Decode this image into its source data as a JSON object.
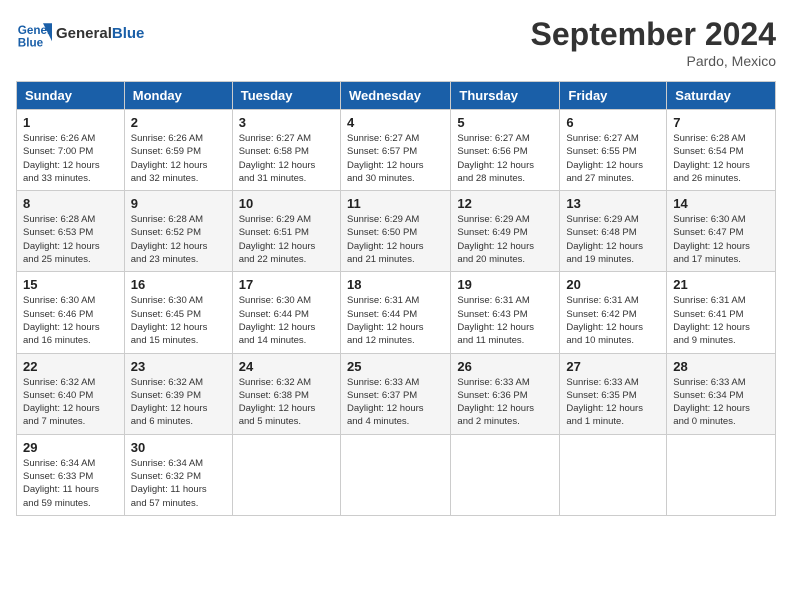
{
  "header": {
    "logo_line1": "General",
    "logo_line2": "Blue",
    "month_title": "September 2024",
    "location": "Pardo, Mexico"
  },
  "days_of_week": [
    "Sunday",
    "Monday",
    "Tuesday",
    "Wednesday",
    "Thursday",
    "Friday",
    "Saturday"
  ],
  "weeks": [
    [
      {
        "day": "1",
        "info": "Sunrise: 6:26 AM\nSunset: 7:00 PM\nDaylight: 12 hours\nand 33 minutes."
      },
      {
        "day": "2",
        "info": "Sunrise: 6:26 AM\nSunset: 6:59 PM\nDaylight: 12 hours\nand 32 minutes."
      },
      {
        "day": "3",
        "info": "Sunrise: 6:27 AM\nSunset: 6:58 PM\nDaylight: 12 hours\nand 31 minutes."
      },
      {
        "day": "4",
        "info": "Sunrise: 6:27 AM\nSunset: 6:57 PM\nDaylight: 12 hours\nand 30 minutes."
      },
      {
        "day": "5",
        "info": "Sunrise: 6:27 AM\nSunset: 6:56 PM\nDaylight: 12 hours\nand 28 minutes."
      },
      {
        "day": "6",
        "info": "Sunrise: 6:27 AM\nSunset: 6:55 PM\nDaylight: 12 hours\nand 27 minutes."
      },
      {
        "day": "7",
        "info": "Sunrise: 6:28 AM\nSunset: 6:54 PM\nDaylight: 12 hours\nand 26 minutes."
      }
    ],
    [
      {
        "day": "8",
        "info": "Sunrise: 6:28 AM\nSunset: 6:53 PM\nDaylight: 12 hours\nand 25 minutes."
      },
      {
        "day": "9",
        "info": "Sunrise: 6:28 AM\nSunset: 6:52 PM\nDaylight: 12 hours\nand 23 minutes."
      },
      {
        "day": "10",
        "info": "Sunrise: 6:29 AM\nSunset: 6:51 PM\nDaylight: 12 hours\nand 22 minutes."
      },
      {
        "day": "11",
        "info": "Sunrise: 6:29 AM\nSunset: 6:50 PM\nDaylight: 12 hours\nand 21 minutes."
      },
      {
        "day": "12",
        "info": "Sunrise: 6:29 AM\nSunset: 6:49 PM\nDaylight: 12 hours\nand 20 minutes."
      },
      {
        "day": "13",
        "info": "Sunrise: 6:29 AM\nSunset: 6:48 PM\nDaylight: 12 hours\nand 19 minutes."
      },
      {
        "day": "14",
        "info": "Sunrise: 6:30 AM\nSunset: 6:47 PM\nDaylight: 12 hours\nand 17 minutes."
      }
    ],
    [
      {
        "day": "15",
        "info": "Sunrise: 6:30 AM\nSunset: 6:46 PM\nDaylight: 12 hours\nand 16 minutes."
      },
      {
        "day": "16",
        "info": "Sunrise: 6:30 AM\nSunset: 6:45 PM\nDaylight: 12 hours\nand 15 minutes."
      },
      {
        "day": "17",
        "info": "Sunrise: 6:30 AM\nSunset: 6:44 PM\nDaylight: 12 hours\nand 14 minutes."
      },
      {
        "day": "18",
        "info": "Sunrise: 6:31 AM\nSunset: 6:44 PM\nDaylight: 12 hours\nand 12 minutes."
      },
      {
        "day": "19",
        "info": "Sunrise: 6:31 AM\nSunset: 6:43 PM\nDaylight: 12 hours\nand 11 minutes."
      },
      {
        "day": "20",
        "info": "Sunrise: 6:31 AM\nSunset: 6:42 PM\nDaylight: 12 hours\nand 10 minutes."
      },
      {
        "day": "21",
        "info": "Sunrise: 6:31 AM\nSunset: 6:41 PM\nDaylight: 12 hours\nand 9 minutes."
      }
    ],
    [
      {
        "day": "22",
        "info": "Sunrise: 6:32 AM\nSunset: 6:40 PM\nDaylight: 12 hours\nand 7 minutes."
      },
      {
        "day": "23",
        "info": "Sunrise: 6:32 AM\nSunset: 6:39 PM\nDaylight: 12 hours\nand 6 minutes."
      },
      {
        "day": "24",
        "info": "Sunrise: 6:32 AM\nSunset: 6:38 PM\nDaylight: 12 hours\nand 5 minutes."
      },
      {
        "day": "25",
        "info": "Sunrise: 6:33 AM\nSunset: 6:37 PM\nDaylight: 12 hours\nand 4 minutes."
      },
      {
        "day": "26",
        "info": "Sunrise: 6:33 AM\nSunset: 6:36 PM\nDaylight: 12 hours\nand 2 minutes."
      },
      {
        "day": "27",
        "info": "Sunrise: 6:33 AM\nSunset: 6:35 PM\nDaylight: 12 hours\nand 1 minute."
      },
      {
        "day": "28",
        "info": "Sunrise: 6:33 AM\nSunset: 6:34 PM\nDaylight: 12 hours\nand 0 minutes."
      }
    ],
    [
      {
        "day": "29",
        "info": "Sunrise: 6:34 AM\nSunset: 6:33 PM\nDaylight: 11 hours\nand 59 minutes."
      },
      {
        "day": "30",
        "info": "Sunrise: 6:34 AM\nSunset: 6:32 PM\nDaylight: 11 hours\nand 57 minutes."
      },
      {
        "day": "",
        "info": ""
      },
      {
        "day": "",
        "info": ""
      },
      {
        "day": "",
        "info": ""
      },
      {
        "day": "",
        "info": ""
      },
      {
        "day": "",
        "info": ""
      }
    ]
  ]
}
